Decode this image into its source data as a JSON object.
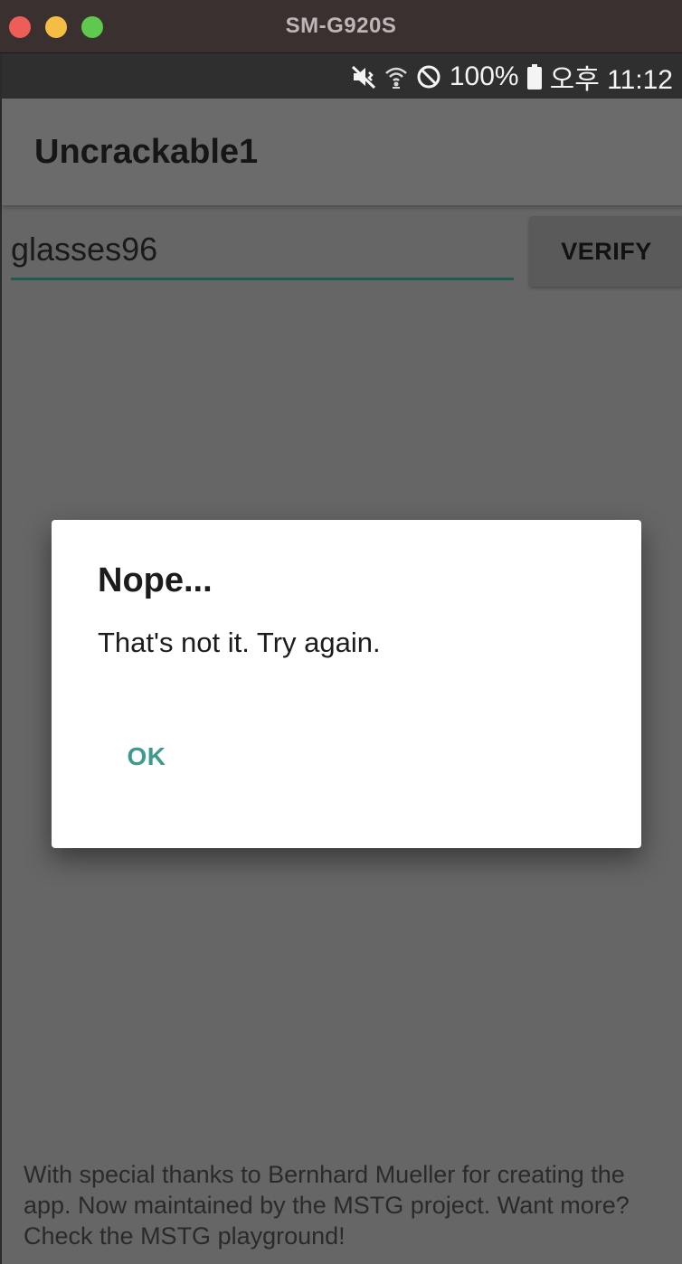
{
  "window": {
    "title": "SM-G920S"
  },
  "statusbar": {
    "icons": [
      "mute-vibrate-icon",
      "wifi-icon",
      "do-not-disturb-icon",
      "battery-icon"
    ],
    "battery_percent": "100%",
    "time": "오후 11:12"
  },
  "app": {
    "title": "Uncrackable1",
    "input_value": "glasses96",
    "verify_label": "VERIFY",
    "footer": "With special thanks to Bernhard Mueller for creating the app. Now maintained by the MSTG project. Want more? Check the MSTG playground!"
  },
  "dialog": {
    "title": "Nope...",
    "message": "That's not it. Try again.",
    "ok_label": "OK"
  },
  "colors": {
    "accent": "#3f9a8e",
    "input_underline": "#1f5a52",
    "scrim_background": "#666666"
  }
}
